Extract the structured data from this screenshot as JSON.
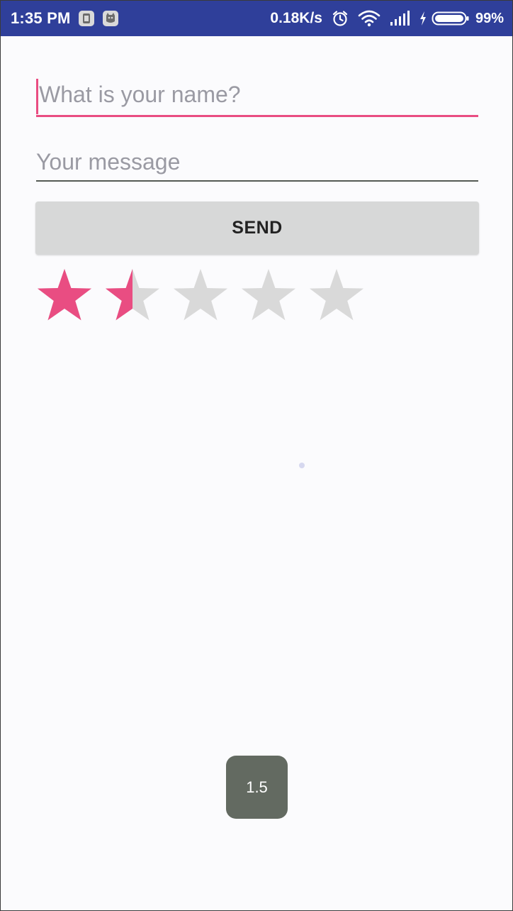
{
  "status_bar": {
    "time": "1:35 PM",
    "net_speed": "0.18K/s",
    "battery": "99%",
    "icons": [
      "notification-icon",
      "cat-app-icon",
      "alarm-icon",
      "wifi-icon",
      "signal-icon",
      "charging-icon",
      "battery-icon"
    ]
  },
  "form": {
    "name_placeholder": "What is your name?",
    "name_value": "",
    "message_placeholder": "Your message",
    "message_value": "",
    "send_label": "SEND"
  },
  "rating": {
    "value": 1.5,
    "max": 5,
    "active_color": "#e94d82",
    "inactive_color": "#d9d9d9"
  },
  "toast": {
    "text": "1.5"
  },
  "colors": {
    "status_bar": "#2f3f9a",
    "accent": "#e94d82",
    "background": "#fbfbfd"
  }
}
